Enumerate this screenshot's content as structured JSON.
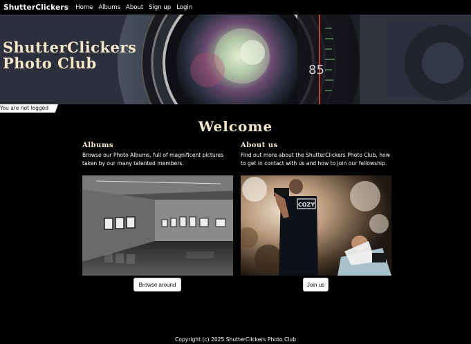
{
  "nav": {
    "brand": "ShutterClickers",
    "links": [
      "Home",
      "Albums",
      "About",
      "Sign up",
      "Login"
    ]
  },
  "hero": {
    "title_line1": "ShutterClickers",
    "title_line2": "Photo Club",
    "lens_marking": "85"
  },
  "status": "You are not logged in",
  "welcome": "Welcome",
  "albums": {
    "heading": "Albums",
    "text": "Browse our Photo Albums, full of magnificent pictures taken by our many talented members.",
    "button": "Browse around"
  },
  "about": {
    "heading": "About us",
    "text": "Find out more about the ShutterClickers Photo Club, how to get in contact with us and how to join our fellowship.",
    "button": "Join us",
    "shirt_text": "COZY"
  },
  "footer": "Copyright (c) 2025 ShutterClickers Photo Club",
  "colors": {
    "background": "#000000",
    "accent_title": "#f4e6c8",
    "button_bg": "#ffffff"
  }
}
